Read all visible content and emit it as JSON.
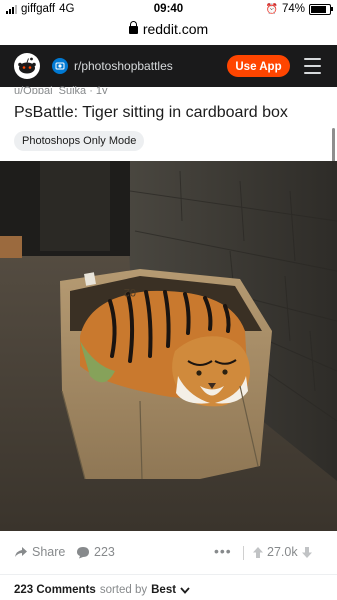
{
  "status_bar": {
    "carrier": "giffgaff",
    "network": "4G",
    "time": "09:40",
    "battery": "74%",
    "battery_level": 0.74
  },
  "browser": {
    "url": "reddit.com"
  },
  "nav": {
    "subreddit": "r/photoshopbattles",
    "use_app_label": "Use App",
    "icons": [
      "reddit-snoo-icon",
      "subreddit-icon",
      "hamburger-menu-icon"
    ]
  },
  "post": {
    "author_meta": "u/Oppai_Suika · 1y",
    "title": "PsBattle: Tiger sitting in cardboard box",
    "flair": "Photoshops Only Mode",
    "box_text": "02"
  },
  "actions": {
    "share_label": "Share",
    "comment_count": "223",
    "more_label": "•••",
    "vote_count": "27.0k"
  },
  "comments": {
    "count_label": "223 Comments",
    "sorted_by_label": "sorted by",
    "sort_value": "Best"
  },
  "colors": {
    "nav_bg": "#1a1a1b",
    "accent": "#ff4500",
    "subreddit_icon": "#0079d3"
  }
}
